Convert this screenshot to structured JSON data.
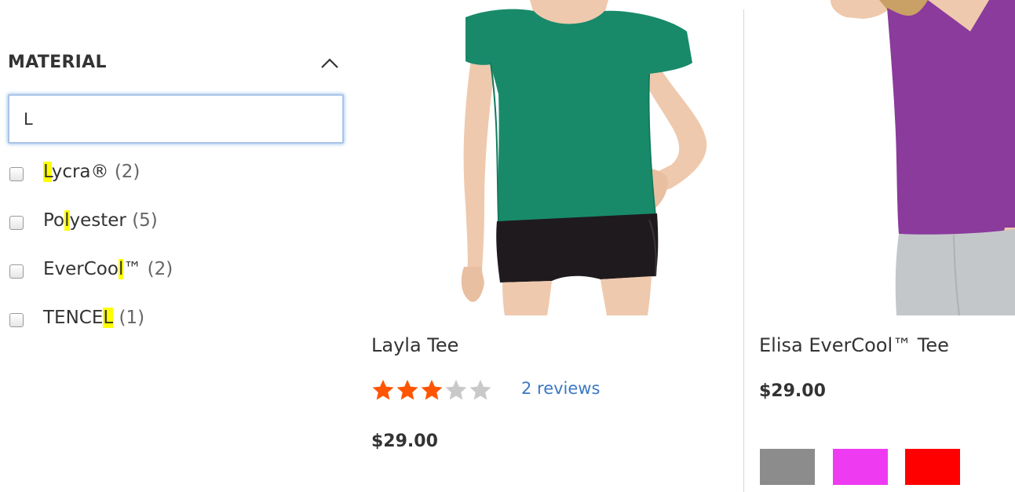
{
  "filter": {
    "title": "MATERIAL",
    "search_value": "L",
    "options": [
      {
        "pre": "",
        "match": "L",
        "post": "ycra®",
        "count": "(2)"
      },
      {
        "pre": "Po",
        "match": "l",
        "post": "yester",
        "count": "(5)"
      },
      {
        "pre": "EverCoo",
        "match": "l",
        "post": "™",
        "count": "(2)"
      },
      {
        "pre": "TENCE",
        "match": "L",
        "post": "",
        "count": "(1)"
      }
    ]
  },
  "products": [
    {
      "name": "Layla Tee",
      "rating_stars": 3,
      "rating_max": 5,
      "reviews": "2 reviews",
      "price": "$29.00"
    },
    {
      "name": "Elisa EverCool™ Tee",
      "price": "$29.00",
      "swatches": [
        {
          "color": "#8c8c8c"
        },
        {
          "color": "#ee3bf2"
        },
        {
          "color": "#ff0000"
        }
      ]
    }
  ],
  "colors": {
    "star_filled": "#ff5501",
    "star_empty": "#c9c9c9",
    "link": "#3b78c4",
    "highlight": "#ffff00"
  }
}
